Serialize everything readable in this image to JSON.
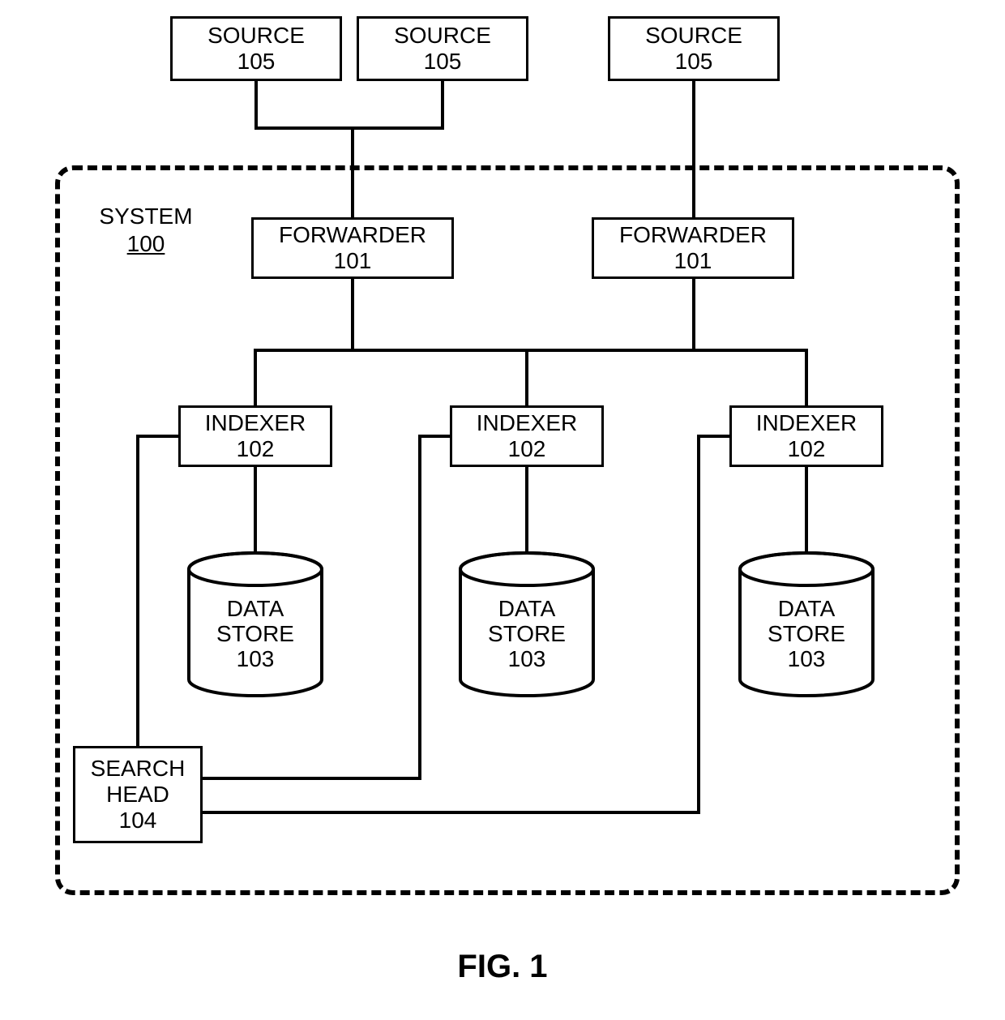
{
  "figure_caption": "FIG. 1",
  "system": {
    "label": "SYSTEM",
    "ref": "100"
  },
  "sources": [
    {
      "label": "SOURCE",
      "ref": "105"
    },
    {
      "label": "SOURCE",
      "ref": "105"
    },
    {
      "label": "SOURCE",
      "ref": "105"
    }
  ],
  "forwarders": [
    {
      "label": "FORWARDER",
      "ref": "101"
    },
    {
      "label": "FORWARDER",
      "ref": "101"
    }
  ],
  "indexers": [
    {
      "label": "INDEXER",
      "ref": "102"
    },
    {
      "label": "INDEXER",
      "ref": "102"
    },
    {
      "label": "INDEXER",
      "ref": "102"
    }
  ],
  "datastores": [
    {
      "label1": "DATA",
      "label2": "STORE",
      "ref": "103"
    },
    {
      "label1": "DATA",
      "label2": "STORE",
      "ref": "103"
    },
    {
      "label1": "DATA",
      "label2": "STORE",
      "ref": "103"
    }
  ],
  "search_head": {
    "label1": "SEARCH",
    "label2": "HEAD",
    "ref": "104"
  }
}
